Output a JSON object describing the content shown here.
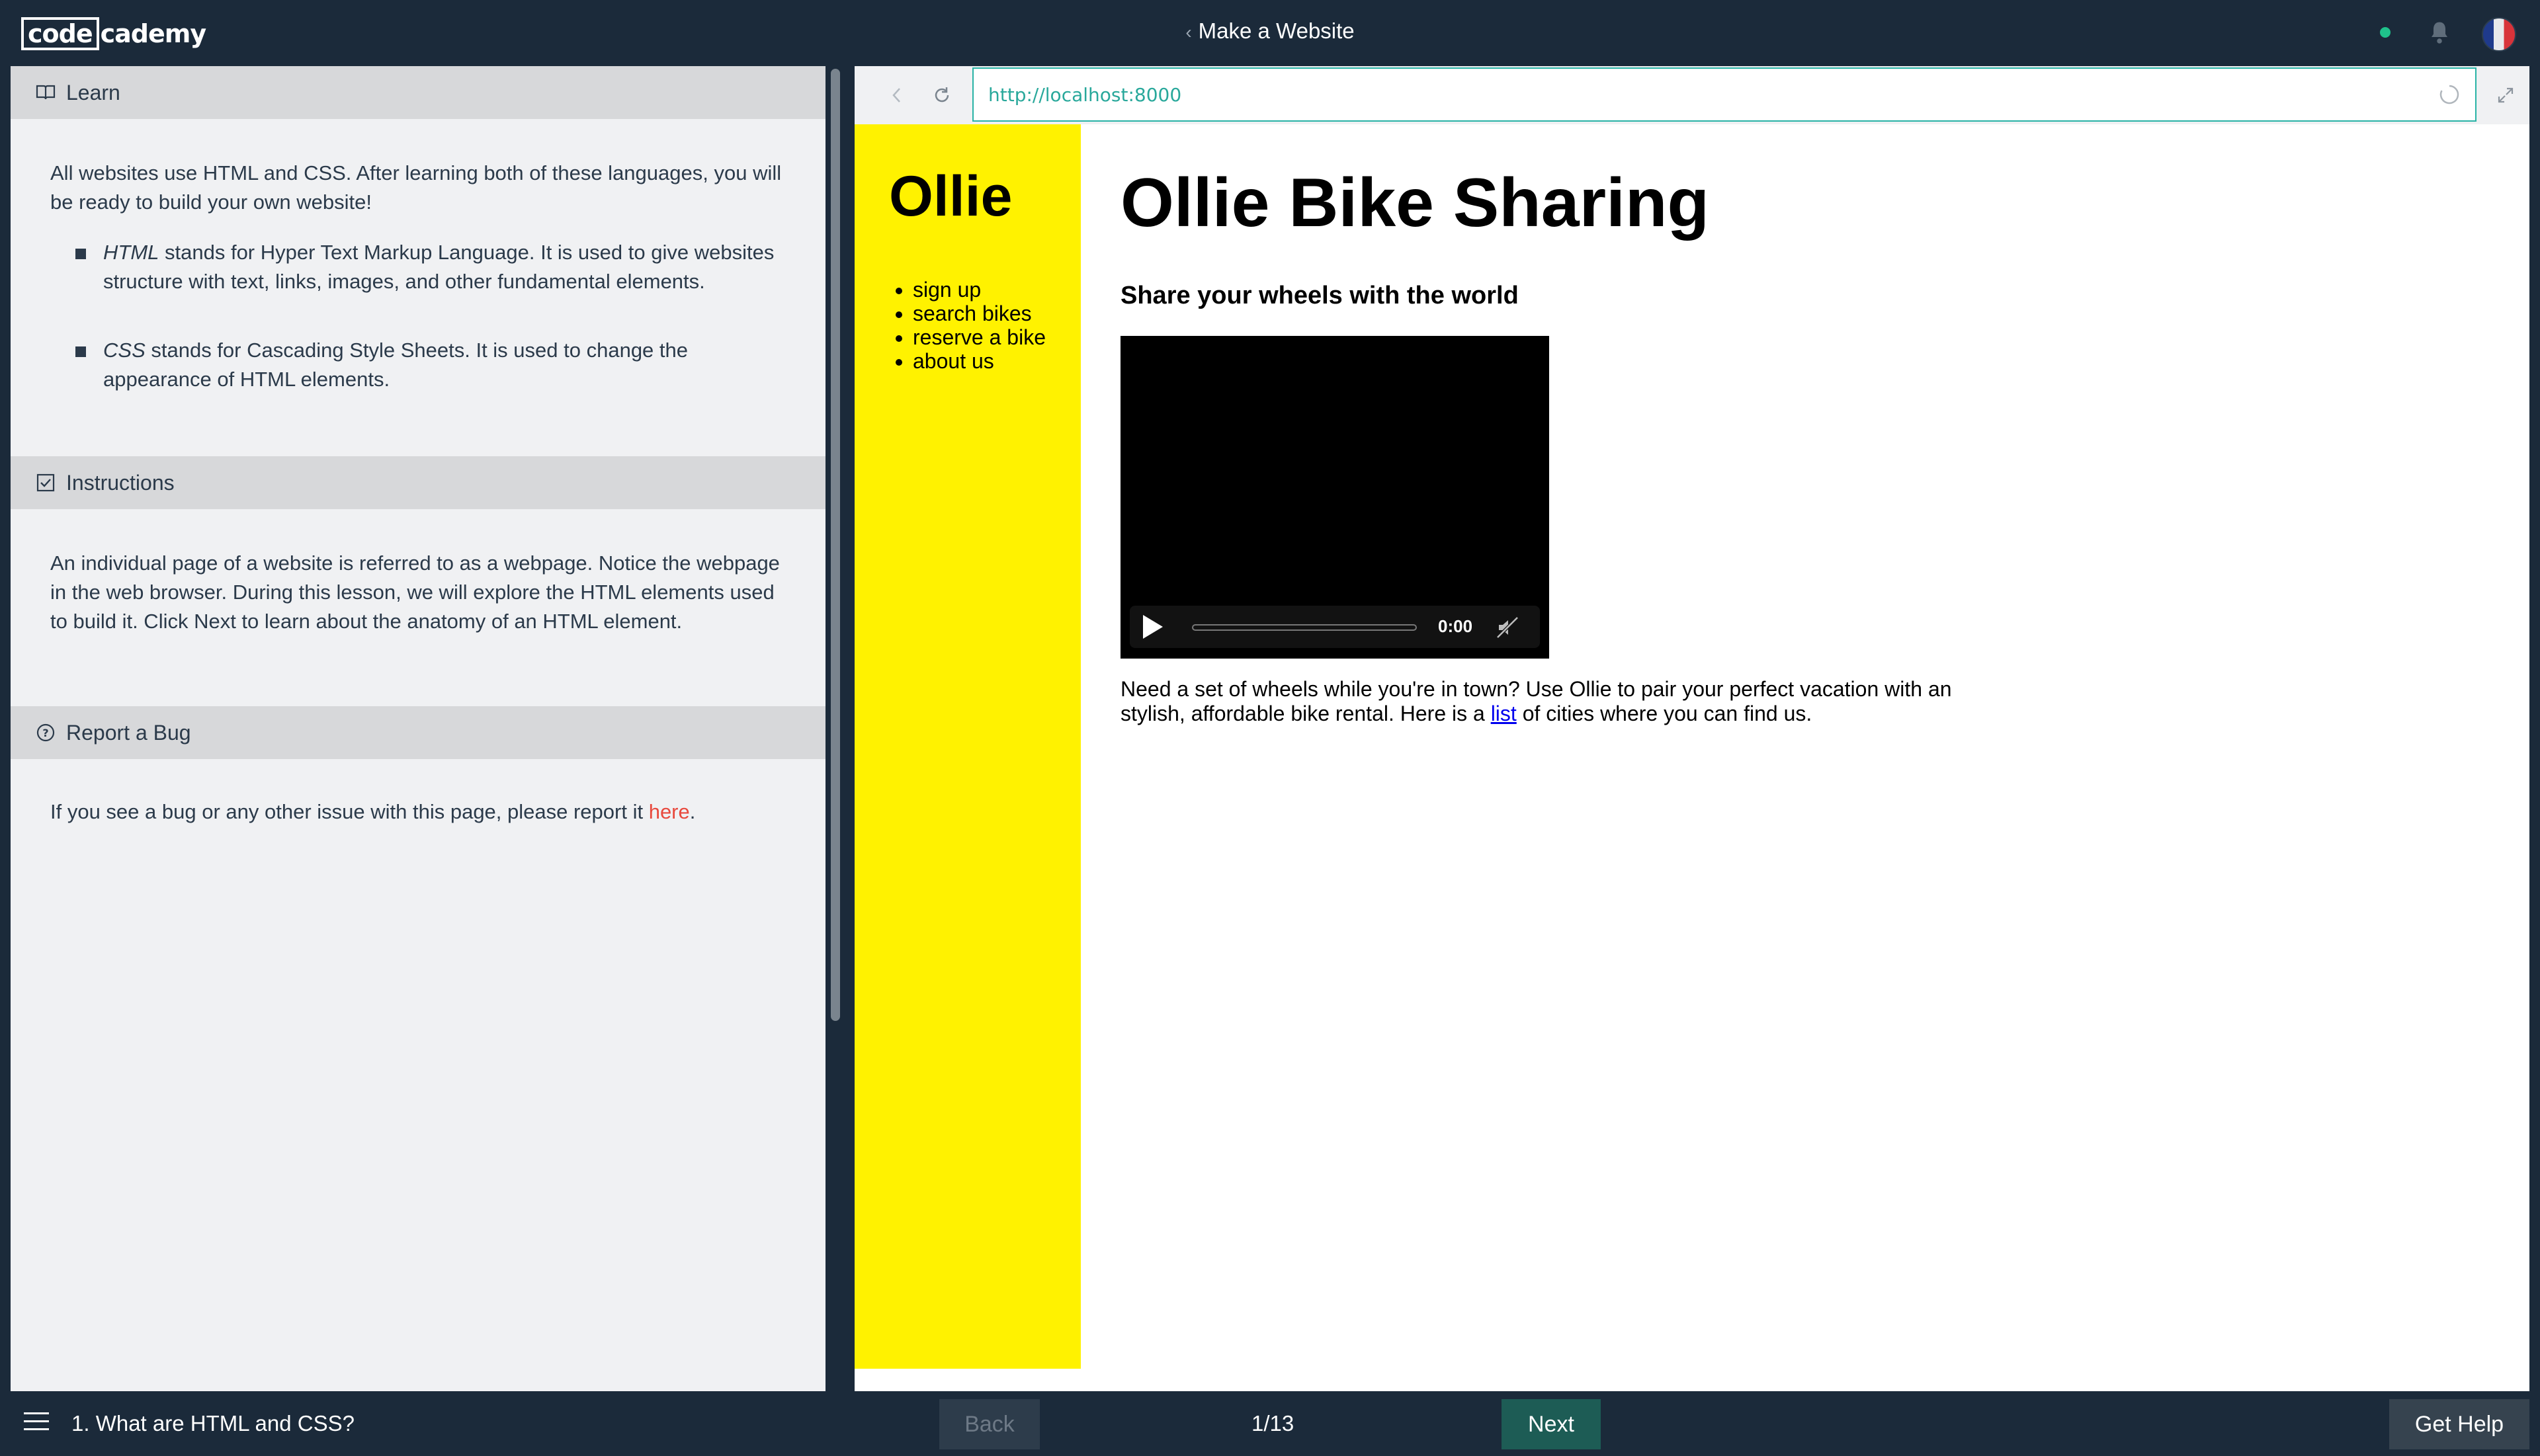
{
  "header": {
    "logo_part1": "code",
    "logo_part2": "cademy",
    "back_chevron": "‹",
    "project_title": "Make a Website",
    "icons": [
      "status-dot",
      "bell-icon",
      "avatar"
    ]
  },
  "sidebar": {
    "learn": {
      "header": "Learn",
      "intro": "All websites use HTML and CSS. After learning both of these languages, you will be ready to build your own website!",
      "bullets": [
        {
          "term": "HTML",
          "text": " stands for Hyper Text Markup Language. It is used to give websites structure with text, links, images, and other fundamental elements."
        },
        {
          "term": "CSS",
          "text": " stands for Cascading Style Sheets. It is used to change the appearance of HTML elements."
        }
      ]
    },
    "instructions": {
      "header": "Instructions",
      "text": "An individual page of a website is referred to as a webpage. Notice the webpage in the web browser. During this lesson, we will explore the HTML elements used to build it. Click Next to learn about the anatomy of an HTML element."
    },
    "report": {
      "header": "Report a Bug",
      "text_before": "If you see a bug or any other issue with this page, please report it ",
      "link": "here",
      "text_after": "."
    }
  },
  "browser": {
    "url": "http://localhost:8000",
    "page": {
      "side_logo": "Ollie",
      "nav": [
        "sign up",
        "search bikes",
        "reserve a bike",
        "about us"
      ],
      "title": "Ollie Bike Sharing",
      "tagline": "Share your wheels with the world",
      "video_time": "0:00",
      "body_before": "Need a set of wheels while you're in town? Use Ollie to pair your perfect vacation with an stylish, affordable bike rental. Here is a ",
      "body_link": "list",
      "body_after": " of cities where you can find us."
    }
  },
  "footer": {
    "lesson_title": "1. What are HTML and CSS?",
    "back_label": "Back",
    "progress": "1/13",
    "next_label": "Next",
    "help_label": "Get Help"
  },
  "colors": {
    "chrome": "#1b2a3a",
    "accent_teal": "#29b3a6",
    "yellow": "#fff200",
    "link_red": "#e8493d",
    "next_green": "#1d5c55"
  }
}
